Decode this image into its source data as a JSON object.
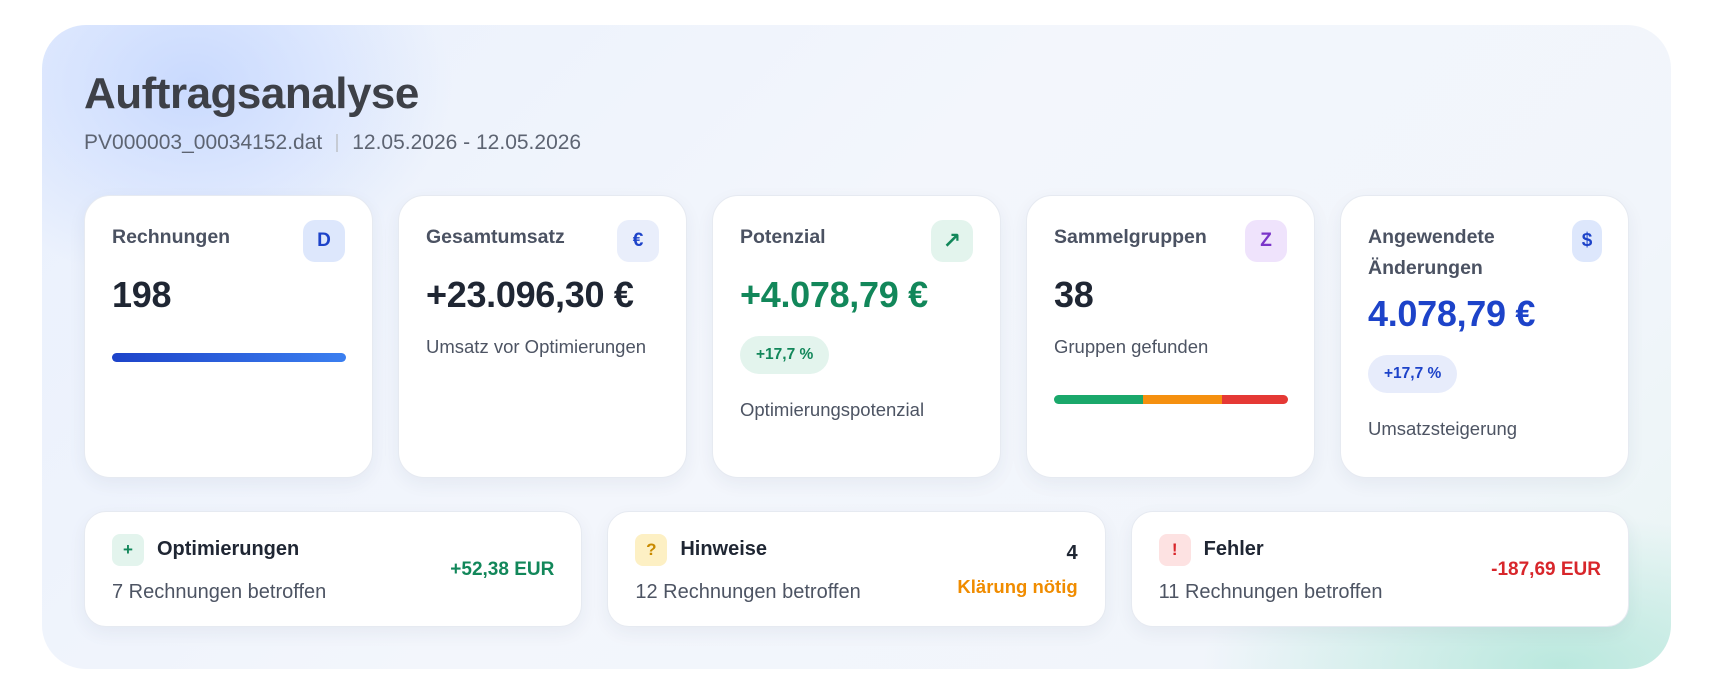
{
  "header": {
    "title": "Auftragsanalyse",
    "file": "PV000003_00034152.dat",
    "date_range": "12.05.2026 - 12.05.2026"
  },
  "kpis": [
    {
      "label": "Rechnungen",
      "icon": "D",
      "icon_name": "document-letter-icon",
      "value": "198"
    },
    {
      "label": "Gesamtumsatz",
      "icon": "€",
      "icon_name": "euro-icon",
      "value": "+23.096,30 €",
      "sub": "Umsatz vor Optimierungen"
    },
    {
      "label": "Potenzial",
      "icon": "↗",
      "icon_name": "trend-up-icon",
      "value": "+4.078,79 €",
      "pill": "+17,7 %",
      "sub": "Optimierungspotenzial"
    },
    {
      "label": "Sammelgruppen",
      "icon": "Z",
      "icon_name": "group-letter-icon",
      "value": "38",
      "sub": "Gruppen gefunden",
      "segments": [
        {
          "fraction": 0.38,
          "color": "#1aa86b"
        },
        {
          "fraction": 0.34,
          "color": "#f5900f"
        },
        {
          "fraction": 0.28,
          "color": "#e53935"
        }
      ]
    },
    {
      "label": "Angewendete Änderungen",
      "icon": "$",
      "icon_name": "dollar-icon",
      "value": "4.078,79 €",
      "pill": "+17,7 %",
      "sub": "Umsatzsteigerung"
    }
  ],
  "info_cards": [
    {
      "icon": "+",
      "icon_name": "plus-icon",
      "title": "Optimierungen",
      "sub": "7 Rechnungen betroffen",
      "amount": "+52,38 EUR"
    },
    {
      "icon": "?",
      "icon_name": "question-icon",
      "title": "Hinweise",
      "sub": "12 Rechnungen betroffen",
      "count": "4",
      "status": "Klärung nötig"
    },
    {
      "icon": "!",
      "icon_name": "exclamation-icon",
      "title": "Fehler",
      "sub": "11 Rechnungen betroffen",
      "amount": "-187,69 EUR"
    }
  ],
  "colors": {
    "accent_blue": "#1d43c9",
    "positive_green": "#12875a",
    "warning_orange": "#f08c00",
    "negative_red": "#d8262b"
  }
}
